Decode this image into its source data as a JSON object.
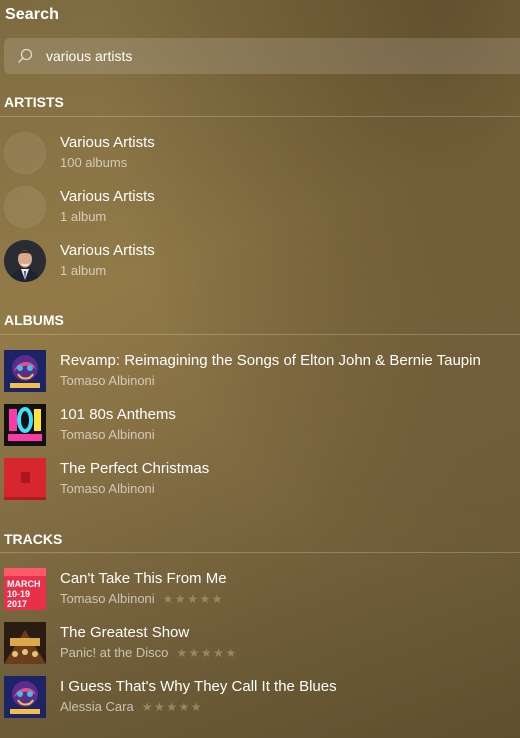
{
  "header": {
    "title": "Search"
  },
  "search": {
    "value": "various artists",
    "icon": "search-icon"
  },
  "sections": {
    "artists": "ARTISTS",
    "albums": "ALBUMS",
    "tracks": "TRACKS"
  },
  "artists": [
    {
      "name": "Various Artists",
      "meta": "100 albums",
      "image": "placeholder"
    },
    {
      "name": "Various Artists",
      "meta": "1 album",
      "image": "placeholder"
    },
    {
      "name": "Various Artists",
      "meta": "1 album",
      "image": "portrait-photo"
    }
  ],
  "albums": [
    {
      "title": "Revamp: Reimagining the Songs of Elton John & Bernie Taupin",
      "artist": "Tomaso Albinoni",
      "art": "revamp-cover"
    },
    {
      "title": "101 80s Anthems",
      "artist": "Tomaso Albinoni",
      "art": "101-cover"
    },
    {
      "title": "The Perfect Christmas",
      "artist": "Tomaso Albinoni",
      "art": "red-cover"
    }
  ],
  "tracks": [
    {
      "title": "Can't Take This From Me",
      "artist": "Tomaso Albinoni",
      "rating": 0,
      "rating_max": 5,
      "art": "march-cover",
      "art_text": [
        "MARCH",
        "10-19",
        "2017"
      ]
    },
    {
      "title": "The Greatest Show",
      "artist": "Panic! at the Disco",
      "rating": 0,
      "rating_max": 5,
      "art": "showman-cover"
    },
    {
      "title": "I Guess That's Why They Call It the Blues",
      "artist": "Alessia Cara",
      "rating": 0,
      "rating_max": 5,
      "art": "revamp-cover"
    }
  ],
  "colors": {
    "star_empty": "#a89a78",
    "accent_red": "#d8262f"
  }
}
